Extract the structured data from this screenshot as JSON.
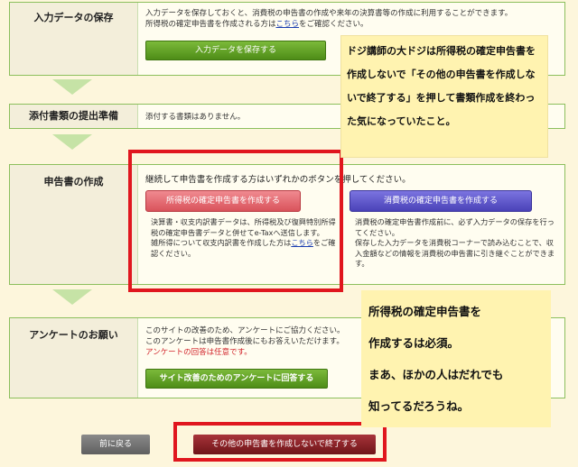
{
  "sections": {
    "save": {
      "label": "入力データの保存",
      "desc1": "入力データを保存しておくと、消費税の申告書の作成や来年の決算書等の作成に利用することができます。",
      "desc2_pre": "所得税の確定申告書を作成される方は",
      "desc2_link": "こちら",
      "desc2_post": "をご確認ください。",
      "button": "入力データを保存する"
    },
    "attach": {
      "label": "添付書類の提出準備",
      "desc": "添付する書類はありません。"
    },
    "create": {
      "label": "申告書の作成",
      "intro": "継続して申告書を作成する方はいずれかのボタンを押してください。",
      "income_button": "所得税の確定申告書を作成する",
      "income_desc1": "決算書・収支内訳書データは、所得税及び復興特別所得税の確定申告書データと併せてe-Taxへ送信します。",
      "income_desc2_pre": "雑所得について収支内訳書を作成した方は",
      "income_desc2_link": "こちら",
      "income_desc2_post": "をご確認ください。",
      "consumption_button": "消費税の確定申告書を作成する",
      "consumption_desc1": "消費税の確定申告書作成前に、必ず入力データの保存を行ってください。",
      "consumption_desc2": "保存した入力データを消費税コーナーで読み込むことで、収入金額などの情報を消費税の申告書に引き継ぐことができます。"
    },
    "survey": {
      "label": "アンケートのお願い",
      "desc1": "このサイトの改善のため、アンケートにご協力ください。",
      "desc2": "このアンケートは申告書作成後にもお答えいただけます。",
      "desc3": "アンケートの回答は任意です。",
      "button": "サイト改善のためのアンケートに回答する"
    }
  },
  "footer": {
    "back": "前に戻る",
    "finish": "その他の申告書を作成しないで終了する"
  },
  "notes": {
    "top": "ドジ講師の大ドジは所得税の確定申告書を作成しないで「その他の申告書を作成しないで終了する」を押して書類作成を終わった気になっていたこと。",
    "bottom_l1": "所得税の確定申告書を",
    "bottom_l2": "作成するは必須。",
    "bottom_l3": "まあ、ほかの人はだれでも",
    "bottom_l4": "知ってるだろうね。"
  },
  "colors": {
    "green": "#5a9e1e",
    "income_button": "#e56a70",
    "consumption_button": "#5a52c8",
    "highlight_red": "#e0161e",
    "note_bg": "#fff3b0"
  }
}
